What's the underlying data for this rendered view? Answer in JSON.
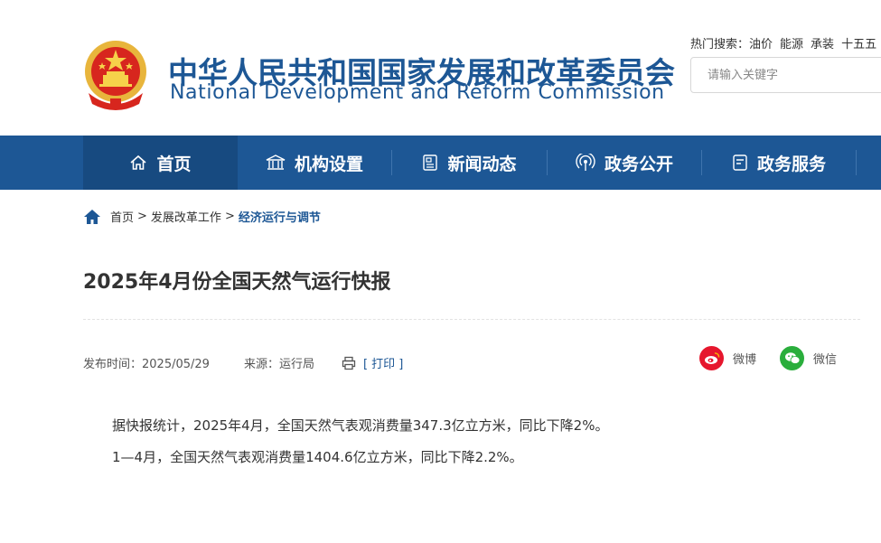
{
  "header": {
    "title_cn": "中华人民共和国国家发展和改革委员会",
    "title_en": "National Development and Reform Commission",
    "emblem_icon": "national-emblem-icon",
    "hot_search_label": "热门搜索：",
    "hot_search_items": [
      "油价",
      "能源",
      "承装",
      "十五五"
    ],
    "search_placeholder": "请输入关键字"
  },
  "nav": {
    "items": [
      {
        "label": "首页",
        "icon": "home-icon"
      },
      {
        "label": "机构设置",
        "icon": "institution-icon"
      },
      {
        "label": "新闻动态",
        "icon": "news-icon"
      },
      {
        "label": "政务公开",
        "icon": "broadcast-icon"
      },
      {
        "label": "政务服务",
        "icon": "service-icon"
      }
    ]
  },
  "breadcrumb": {
    "items": [
      "首页",
      "发展改革工作",
      "经济运行与调节"
    ],
    "separator": ">"
  },
  "article": {
    "title": "2025年4月份全国天然气运行快报",
    "publish_label": "发布时间：2025/05/29",
    "source_label": "来源：运行局",
    "print_label": "[ 打印 ]",
    "share_weibo": "微博",
    "share_weixin": "微信",
    "paragraphs": [
      "据快报统计，2025年4月，全国天然气表观消费量347.3亿立方米，同比下降2%。",
      "1—4月，全国天然气表观消费量1404.6亿立方米，同比下降2.2%。"
    ]
  },
  "colors": {
    "brand_blue": "#1d5795",
    "nav_active": "#174a80",
    "weibo_red": "#e6162d",
    "weixin_green": "#2aae3c"
  }
}
